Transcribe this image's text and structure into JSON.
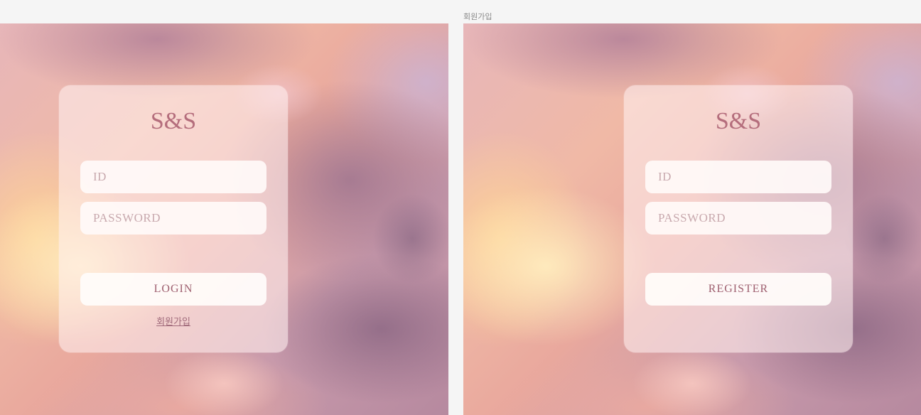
{
  "frames": {
    "register_label": "회원가입"
  },
  "login": {
    "logo": "S&S",
    "id_placeholder": "ID",
    "password_placeholder": "PASSWORD",
    "submit_label": "LOGIN",
    "signup_link": "회원가입"
  },
  "register": {
    "logo": "S&S",
    "id_placeholder": "ID",
    "password_placeholder": "PASSWORD",
    "submit_label": "REGISTER"
  },
  "colors": {
    "accent": "#b46d7c",
    "button_text": "#9e5f6f",
    "placeholder": "#c8a9ae",
    "canvas_bg": "#f5f5f5"
  }
}
